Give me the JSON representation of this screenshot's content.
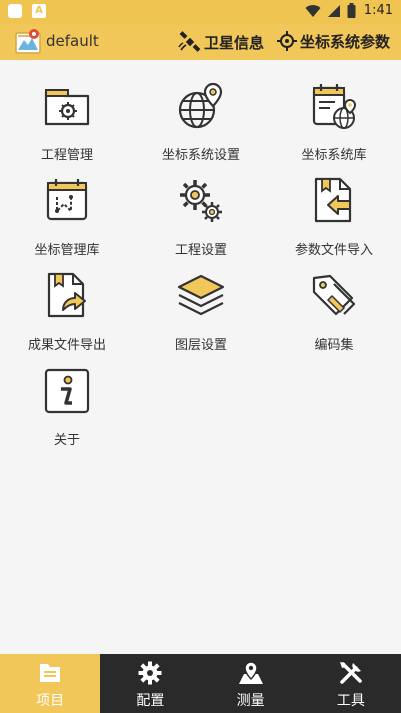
{
  "status_bar": {
    "time": "1:41",
    "app_indicator": "A"
  },
  "header": {
    "title": "default",
    "actions": [
      {
        "label": "卫星信息",
        "icon": "satellite-icon"
      },
      {
        "label": "坐标系统参数",
        "icon": "crosshair-icon"
      }
    ]
  },
  "menu": {
    "items": [
      {
        "label": "工程管理",
        "icon": "project-folder-icon"
      },
      {
        "label": "坐标系统设置",
        "icon": "globe-pin-icon"
      },
      {
        "label": "坐标系统库",
        "icon": "calendar-globe-icon"
      },
      {
        "label": "坐标管理库",
        "icon": "calendar-route-icon"
      },
      {
        "label": "工程设置",
        "icon": "gears-icon"
      },
      {
        "label": "参数文件导入",
        "icon": "file-import-icon"
      },
      {
        "label": "成果文件导出",
        "icon": "file-export-icon"
      },
      {
        "label": "图层设置",
        "icon": "layers-icon"
      },
      {
        "label": "编码集",
        "icon": "tags-icon"
      },
      {
        "label": "关于",
        "icon": "info-icon"
      }
    ]
  },
  "nav": {
    "items": [
      {
        "label": "项目",
        "icon": "project-list-icon",
        "active": true
      },
      {
        "label": "配置",
        "icon": "gear-icon",
        "active": false
      },
      {
        "label": "测量",
        "icon": "map-pin-icon",
        "active": false
      },
      {
        "label": "工具",
        "icon": "tools-icon",
        "active": false
      }
    ]
  },
  "colors": {
    "accent": "#f2c75a",
    "nav_bg": "#2a2a2a",
    "icon_stroke": "#333333"
  }
}
